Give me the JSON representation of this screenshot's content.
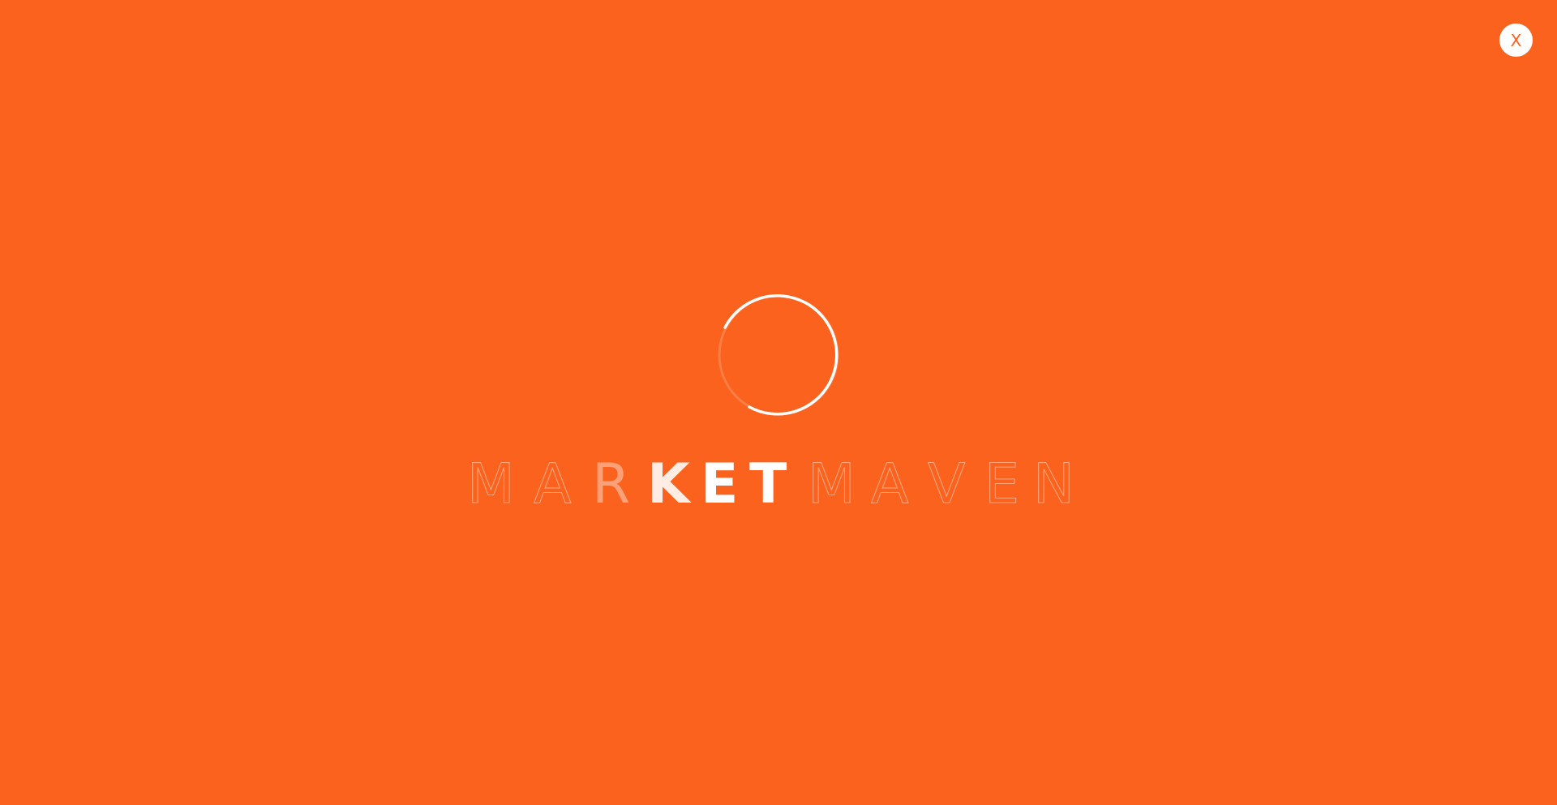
{
  "overlay": {
    "close_label": "X",
    "background_color": "#fb621d",
    "foreground_color": "#ffffff"
  },
  "loader": {
    "icon": "spinner-icon"
  },
  "brand": {
    "wordmark": "MARKETMAVEN",
    "letters": [
      "M",
      "A",
      "R",
      "K",
      "E",
      "T",
      "M",
      "A",
      "V",
      "E",
      "N"
    ]
  }
}
